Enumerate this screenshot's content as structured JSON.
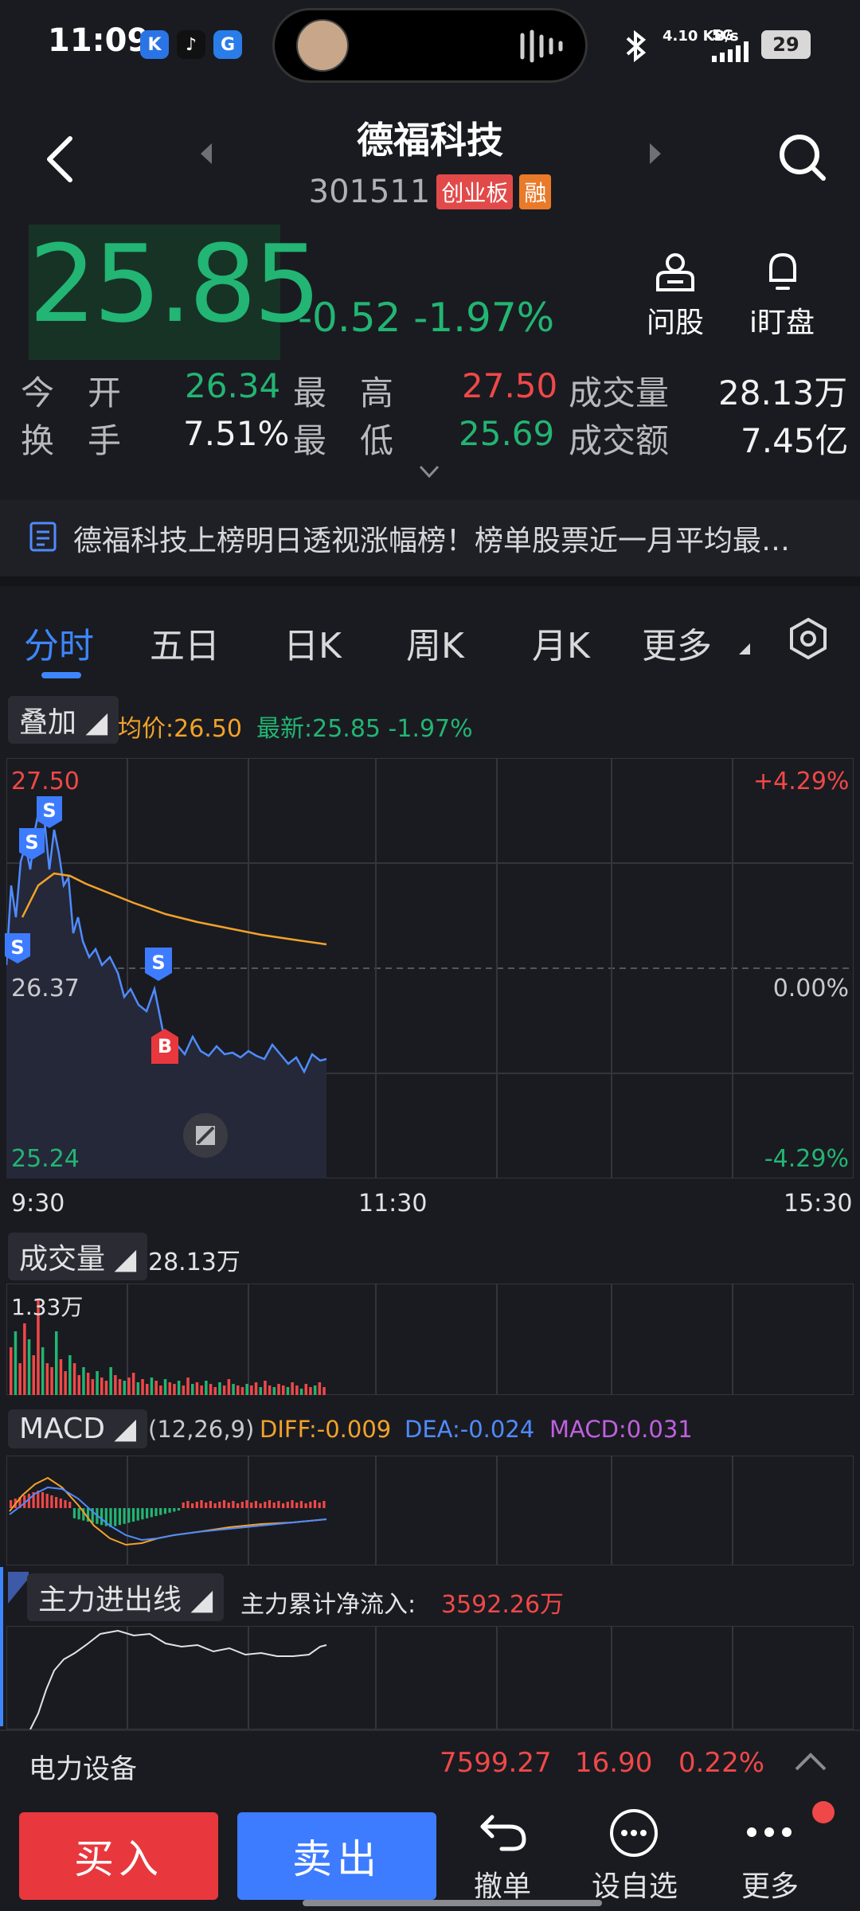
{
  "status": {
    "time": "11:09",
    "net_speed": "4.10 KB/s",
    "net_type": "5G",
    "battery": "29"
  },
  "header": {
    "title": "德福科技",
    "code": "301511",
    "tag_board": "创业板",
    "tag_rong": "融"
  },
  "quote": {
    "price": "25.85",
    "change": "-0.52",
    "change_pct": "-1.97%",
    "ask_label": "问股",
    "watch_label": "i盯盘"
  },
  "stats": {
    "open_label": "今　开",
    "open": "26.34",
    "high_label": "最　高",
    "high": "27.50",
    "vol_label": "成交量",
    "vol": "28.13万",
    "turnover_label": "换　手",
    "turnover": "7.51%",
    "low_label": "最　低",
    "low": "25.69",
    "amount_label": "成交额",
    "amount": "7.45亿"
  },
  "news": {
    "text": "德福科技上榜明日透视涨幅榜！榜单股票近一月平均最…"
  },
  "tabs": [
    "分时",
    "五日",
    "日K",
    "周K",
    "月K",
    "更多"
  ],
  "overlay": {
    "chip": "叠加",
    "avg": "均价:26.50",
    "latest": "最新:25.85 -1.97%"
  },
  "intraday": {
    "y_top": "27.50",
    "y_mid": "26.37",
    "y_bot": "25.24",
    "pct_top": "+4.29%",
    "pct_mid": "0.00%",
    "pct_bot": "-4.29%",
    "x_start": "9:30",
    "x_mid": "11:30",
    "x_end": "15:30",
    "marker_s": "S",
    "marker_b": "B"
  },
  "volume": {
    "chip": "成交量",
    "total": "28.13万",
    "max_label": "1.33万"
  },
  "macd": {
    "chip": "MACD",
    "params": "(12,26,9)",
    "diff": "DIFF:-0.009",
    "dea": "DEA:-0.024",
    "macd": "MACD:0.031"
  },
  "flow": {
    "chip": "主力进出线",
    "label": "主力累计净流入:",
    "value": "3592.26万"
  },
  "sector": {
    "name": "电力设备",
    "index": "7599.27",
    "change": "16.90",
    "pct": "0.22%"
  },
  "bottom": {
    "buy": "买入",
    "sell": "卖出",
    "cancel": "撤单",
    "watchlist": "设自选",
    "more": "更多"
  },
  "colors": {
    "up": "#f04848",
    "down": "#22b573",
    "accent": "#3d86ff",
    "avg_line": "#f2a22a",
    "price_line": "#4f8bff",
    "macd": "#c060e0"
  }
}
